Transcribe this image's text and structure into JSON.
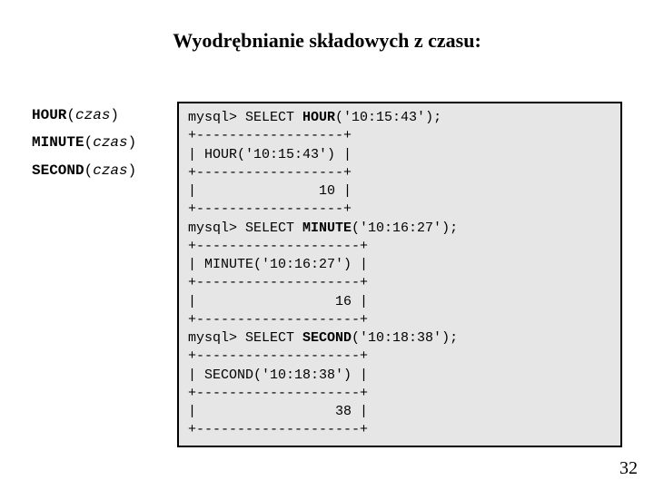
{
  "title": "Wyodrębnianie składowych z czasu:",
  "functions": [
    {
      "name": "HOUR",
      "arg": "czas"
    },
    {
      "name": "MINUTE",
      "arg": "czas"
    },
    {
      "name": "SECOND",
      "arg": "czas"
    }
  ],
  "code": {
    "hour": {
      "prompt": "mysql> SELECT ",
      "keyword": "HOUR",
      "args": "('10:15:43');",
      "sep": "+------------------+",
      "header_row": "| HOUR('10:15:43') |",
      "value_row": "|               10 |"
    },
    "minute": {
      "prompt": "mysql> SELECT ",
      "keyword": "MINUTE",
      "args": "('10:16:27');",
      "sep": "+--------------------+",
      "header_row": "| MINUTE('10:16:27') |",
      "value_row": "|                 16 |"
    },
    "second": {
      "prompt": "mysql> SELECT ",
      "keyword": "SECOND",
      "args": "('10:18:38');",
      "sep": "+--------------------+",
      "header_row": "| SECOND('10:18:38') |",
      "value_row": "|                 38 |"
    }
  },
  "page_number": "32"
}
